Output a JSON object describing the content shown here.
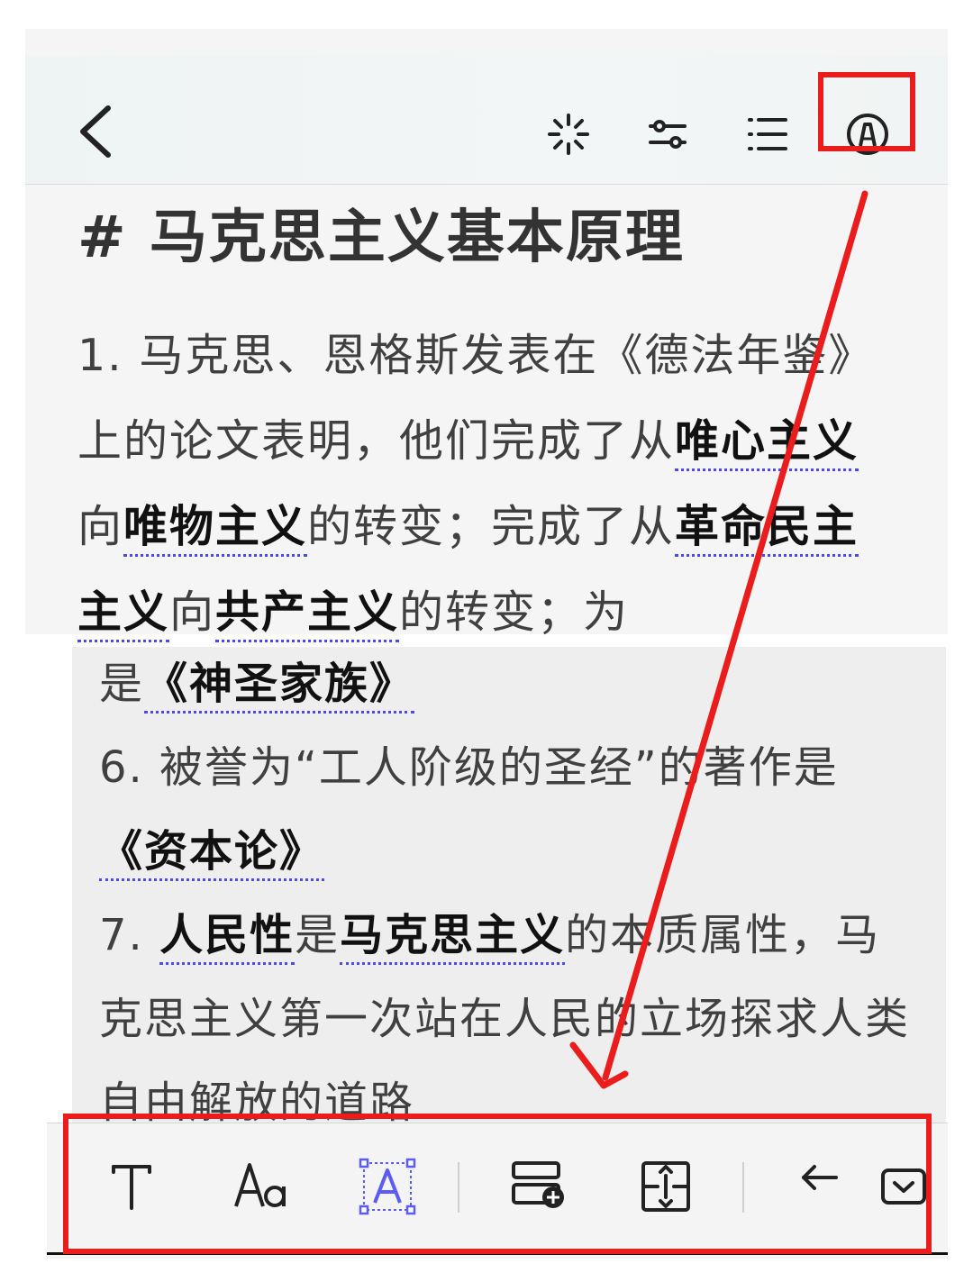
{
  "header": {
    "back_icon": "chevron-left-icon",
    "tools": [
      "sparkle-icon",
      "sliders-icon",
      "list-icon",
      "pen-circle-icon"
    ]
  },
  "document": {
    "title": "# 马克思主义基本原理",
    "para1": {
      "t1": "1. 马克思、恩格斯发表在《德法年鉴》上的论文表明，他们完成了从",
      "k1": "唯心主义",
      "t2": "向",
      "k2": "唯物主义",
      "t3": "的转变；完成了从",
      "k3": "革命民主主义",
      "t4": "向",
      "k4": "共产主义",
      "t5": "的转变；为"
    },
    "para2": {
      "t0": "是",
      "k0": "《神圣家族》",
      "item6": "6. 被誉为“工人阶级的圣经”的著作是",
      "k6": "《资本论》",
      "item7_prefix": "7. ",
      "k7a": "人民性",
      "t7a": "是",
      "k7b": "马克思主义",
      "t7b": "的本质属性，马克思主义第一次站在人民的立场探求人类自由解放的道路"
    }
  },
  "toolbar": {
    "items": [
      "text-icon",
      "font-size-icon",
      "text-box-icon",
      "add-block-icon",
      "align-center-icon",
      "undo-arrow-icon",
      "collapse-icon"
    ]
  },
  "colors": {
    "annotation": "#ea1c1c",
    "keyword_underline": "#4a4af0",
    "selected_tool": "#5b5bf5"
  }
}
